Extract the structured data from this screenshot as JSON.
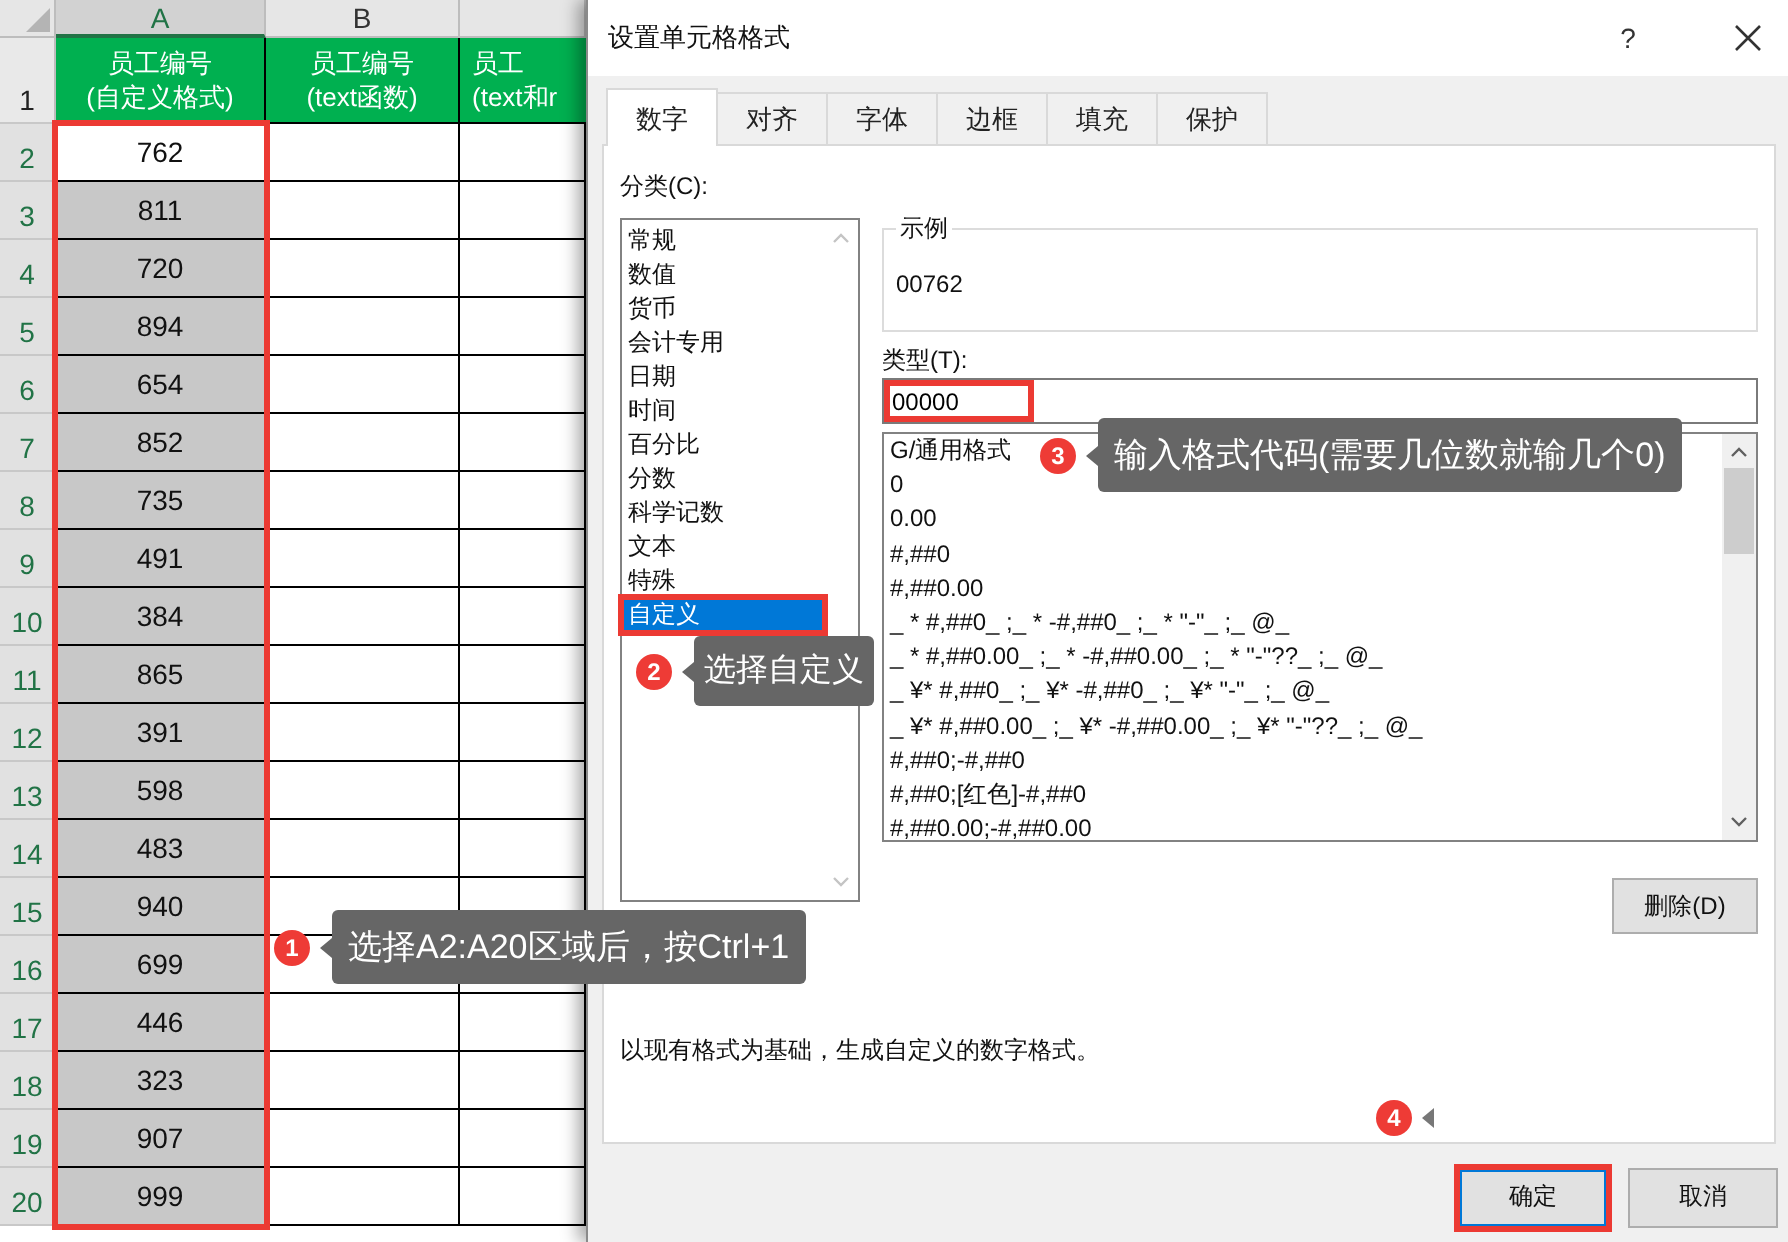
{
  "spreadsheet": {
    "columns": [
      {
        "label": "A",
        "selected": true
      },
      {
        "label": "B",
        "selected": false
      }
    ],
    "header_row": {
      "number": "1",
      "cells": [
        "员工编号\n(自定义格式)",
        "员工编号\n(text函数)",
        "员工\n(text和r"
      ]
    },
    "selection_highlighted": true,
    "rows": [
      {
        "number": "2",
        "value": "762",
        "selected": true,
        "active": true
      },
      {
        "number": "3",
        "value": "811",
        "selected": true,
        "active": false
      },
      {
        "number": "4",
        "value": "720",
        "selected": true,
        "active": false
      },
      {
        "number": "5",
        "value": "894",
        "selected": true,
        "active": false
      },
      {
        "number": "6",
        "value": "654",
        "selected": true,
        "active": false
      },
      {
        "number": "7",
        "value": "852",
        "selected": true,
        "active": false
      },
      {
        "number": "8",
        "value": "735",
        "selected": true,
        "active": false
      },
      {
        "number": "9",
        "value": "491",
        "selected": true,
        "active": false
      },
      {
        "number": "10",
        "value": "384",
        "selected": true,
        "active": false
      },
      {
        "number": "11",
        "value": "865",
        "selected": true,
        "active": false
      },
      {
        "number": "12",
        "value": "391",
        "selected": true,
        "active": false
      },
      {
        "number": "13",
        "value": "598",
        "selected": true,
        "active": false
      },
      {
        "number": "14",
        "value": "483",
        "selected": true,
        "active": false
      },
      {
        "number": "15",
        "value": "940",
        "selected": true,
        "active": false
      },
      {
        "number": "16",
        "value": "699",
        "selected": true,
        "active": false
      },
      {
        "number": "17",
        "value": "446",
        "selected": true,
        "active": false
      },
      {
        "number": "18",
        "value": "323",
        "selected": true,
        "active": false
      },
      {
        "number": "19",
        "value": "907",
        "selected": true,
        "active": false
      },
      {
        "number": "20",
        "value": "999",
        "selected": true,
        "active": false
      }
    ]
  },
  "dialog": {
    "title": "设置单元格格式",
    "help": "?",
    "tabs": [
      {
        "label": "数字",
        "selected": true
      },
      {
        "label": "对齐",
        "selected": false
      },
      {
        "label": "字体",
        "selected": false
      },
      {
        "label": "边框",
        "selected": false
      },
      {
        "label": "填充",
        "selected": false
      },
      {
        "label": "保护",
        "selected": false
      }
    ],
    "category_label": "分类(C):",
    "categories": [
      {
        "label": "常规",
        "selected": false,
        "highlighted": false
      },
      {
        "label": "数值",
        "selected": false,
        "highlighted": false
      },
      {
        "label": "货币",
        "selected": false,
        "highlighted": false
      },
      {
        "label": "会计专用",
        "selected": false,
        "highlighted": false
      },
      {
        "label": "日期",
        "selected": false,
        "highlighted": false
      },
      {
        "label": "时间",
        "selected": false,
        "highlighted": false
      },
      {
        "label": "百分比",
        "selected": false,
        "highlighted": false
      },
      {
        "label": "分数",
        "selected": false,
        "highlighted": false
      },
      {
        "label": "科学记数",
        "selected": false,
        "highlighted": false
      },
      {
        "label": "文本",
        "selected": false,
        "highlighted": false
      },
      {
        "label": "特殊",
        "selected": false,
        "highlighted": false
      },
      {
        "label": "自定义",
        "selected": true,
        "highlighted": true
      }
    ],
    "sample_label": "示例",
    "sample_value": "00762",
    "type_label": "类型(T):",
    "type_value": "00000",
    "type_highlighted": true,
    "formats": [
      "G/通用格式",
      "0",
      "0.00",
      "#,##0",
      "#,##0.00",
      "_ * #,##0_ ;_ * -#,##0_ ;_ * \"-\"_ ;_ @_",
      "_ * #,##0.00_ ;_ * -#,##0.00_ ;_ * \"-\"??_ ;_ @_",
      "_ ¥* #,##0_ ;_ ¥* -#,##0_ ;_ ¥* \"-\"_ ;_ @_",
      "_ ¥* #,##0.00_ ;_ ¥* -#,##0.00_ ;_ ¥* \"-\"??_ ;_ @_",
      "#,##0;-#,##0",
      "#,##0;[红色]-#,##0",
      "#,##0.00;-#,##0.00"
    ],
    "delete_button": "删除(D)",
    "description": "以现有格式为基础，生成自定义的数字格式。",
    "buttons": [
      {
        "label": "确定",
        "default": true,
        "highlighted": true
      },
      {
        "label": "取消",
        "default": false,
        "highlighted": false
      }
    ]
  },
  "callouts": [
    {
      "number": "3",
      "text": "输入格式代码(需要几位数就输几个0)"
    },
    {
      "number": "2",
      "text": "选择自定义"
    },
    {
      "number": "1",
      "text": "选择A2:A20区域后，按Ctrl+1"
    },
    {
      "number": "4"
    }
  ]
}
